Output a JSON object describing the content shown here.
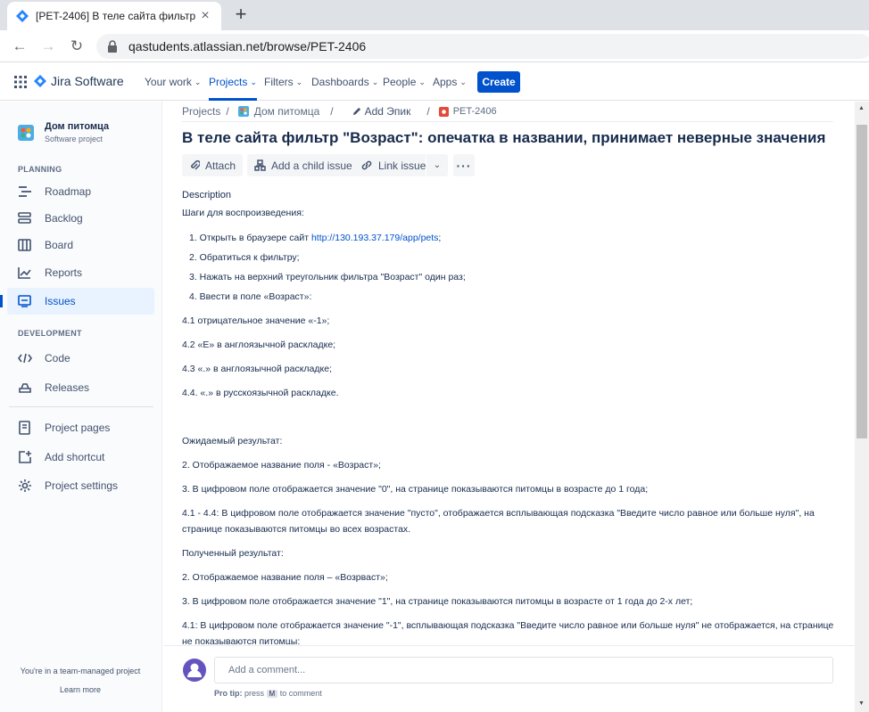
{
  "browser": {
    "tab_title": "[PET-2406] В теле сайта фильтр",
    "url": "qastudents.atlassian.net/browse/PET-2406"
  },
  "topnav": {
    "logo_text": "Jira Software",
    "your_work": "Your work",
    "projects": "Projects",
    "filters": "Filters",
    "dashboards": "Dashboards",
    "people": "People",
    "apps": "Apps",
    "create": "Create"
  },
  "sidebar": {
    "project_name": "Дом питомца",
    "project_type": "Software project",
    "planning_heading": "PLANNING",
    "development_heading": "DEVELOPMENT",
    "items": {
      "roadmap": "Roadmap",
      "backlog": "Backlog",
      "board": "Board",
      "reports": "Reports",
      "issues": "Issues",
      "code": "Code",
      "releases": "Releases",
      "project_pages": "Project pages",
      "add_shortcut": "Add shortcut",
      "project_settings": "Project settings"
    },
    "footer_text": "You're in a team-managed project",
    "learn_more": "Learn more"
  },
  "issue": {
    "breadcrumb": {
      "projects": "Projects",
      "project": "Дом питомца",
      "epic": "Add Эпик",
      "key": "PET-2406"
    },
    "title": "В теле сайта фильтр \"Возраст\": опечатка в названии, принимает неверные значения",
    "actions": {
      "attach": "Attach",
      "add_child": "Add a child issue",
      "link_issue": "Link issue"
    },
    "description_label": "Description",
    "description": {
      "steps_heading": "Шаги для воспроизведения:",
      "step1_prefix": "1. Открыть в браузере сайт ",
      "step1_link": "http://130.193.37.179/app/pets",
      "step1_suffix": ";",
      "step2": "2. Обратиться к фильтру;",
      "step3": "3. Нажать на верхний треугольник фильтра \"Возраст\" один раз;",
      "step4": "4. Ввести в поле «Возраст»:",
      "sub41": "4.1 отрицательное значение «-1»;",
      "sub42": "4.2 «Е» в англоязычной раскладке;",
      "sub43": "4.3  «.» в англоязычной раскладке;",
      "sub44": "4.4. «.» в русскоязычной раскладке.",
      "expected_heading": "Ожидаемый результат:",
      "exp2": "2. Отображаемое название поля - «Возраст»;",
      "exp3": "3. В цифровом поле отображается значение \"0\", на странице показываются питомцы в возрасте до 1 года;",
      "exp4_line1": "4.1 - 4.4: В цифровом поле отображается значение \"пусто\", отображается всплывающая подсказка \"Введите число равное или больше нуля\", на",
      "exp4_line2": "странице показываются питомцы во всех возрастах.",
      "actual_heading": "Полученный результат:",
      "act2": "2. Отображаемое название поля – «Возрваст»;",
      "act3": "3. В цифровом поле отображается значение \"1\", на странице показываются питомцы в возрасте от 1 года до 2-х лет;",
      "act41_line1": "4.1: В цифровом поле отображается значение \"-1\", всплывающая подсказка \"Введите число равное или больше нуля\" не отображается, на странице",
      "act41_line2": "не показываются питомцы;"
    },
    "comment_placeholder": "Add a comment...",
    "protip_label": "Pro tip:",
    "protip_press": "press",
    "protip_key": "M",
    "protip_rest": "to comment"
  },
  "colors": {
    "accent": "#0052cc",
    "sidebar_active": "#e9f2ff"
  }
}
